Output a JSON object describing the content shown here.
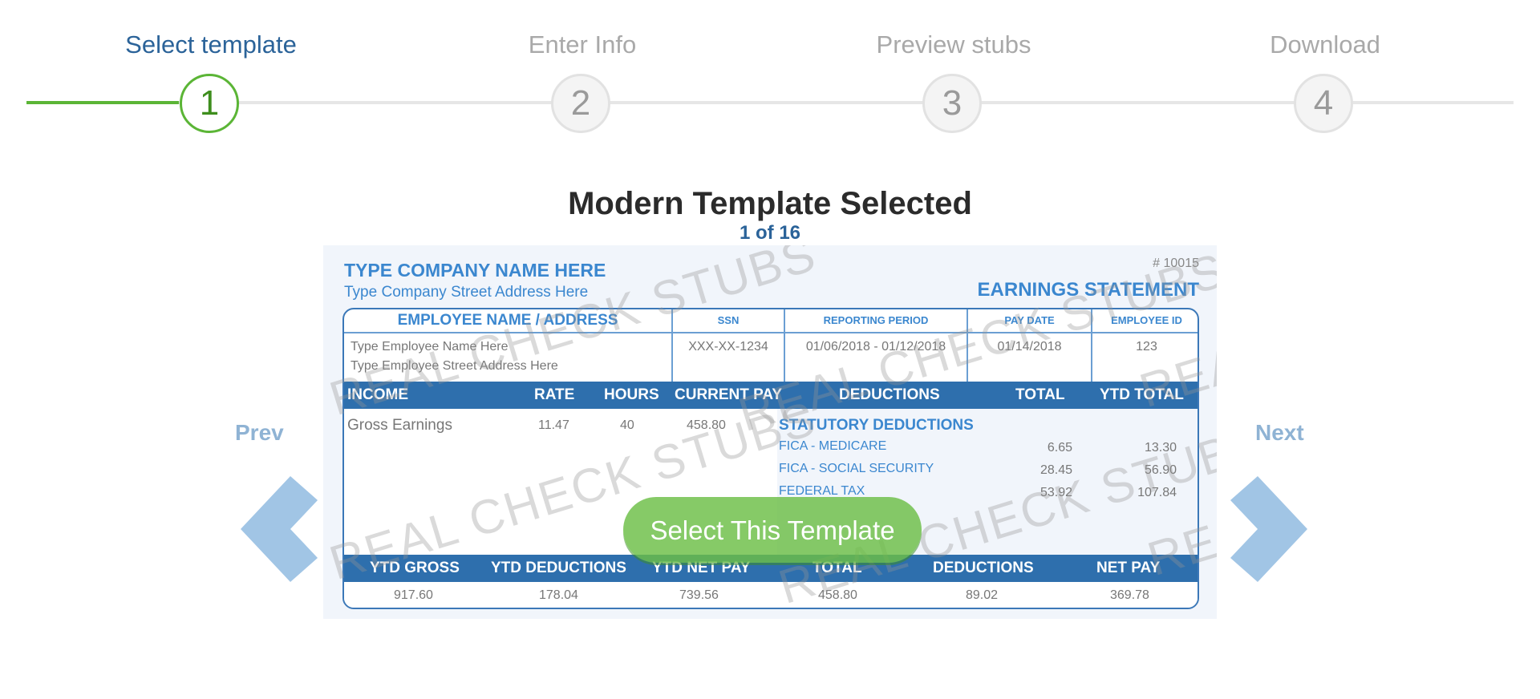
{
  "stepper": {
    "current_step": 1,
    "steps": [
      {
        "number": "1",
        "label": "Select template",
        "state": "active"
      },
      {
        "number": "2",
        "label": "Enter Info",
        "state": "pending"
      },
      {
        "number": "3",
        "label": "Preview stubs",
        "state": "pending"
      },
      {
        "number": "4",
        "label": "Download",
        "state": "pending"
      }
    ]
  },
  "header": {
    "title": "Modern Template Selected",
    "counter": "1 of 16"
  },
  "nav": {
    "prev_label": "Prev",
    "next_label": "Next",
    "prev_icon": "chevron-left-icon",
    "next_icon": "chevron-right-icon"
  },
  "select_button": "Select This Template",
  "stub": {
    "watermark": "REAL CHECK STUBS",
    "company_name": "TYPE COMPANY NAME HERE",
    "company_address": "Type Company Street Address Here",
    "stub_number": "# 10015",
    "heading": "EARNINGS STATEMENT",
    "employee": {
      "header": "EMPLOYEE NAME / ADDRESS",
      "name": "Type Employee Name Here",
      "address": "Type Employee Street Address Here"
    },
    "info": [
      {
        "label": "SSN",
        "value": "XXX-XX-1234"
      },
      {
        "label": "REPORTING PERIOD",
        "value": "01/06/2018 - 01/12/2018"
      },
      {
        "label": "PAY DATE",
        "value": "01/14/2018"
      },
      {
        "label": "EMPLOYEE ID",
        "value": "123"
      }
    ],
    "earnings_headers": [
      "INCOME",
      "RATE",
      "HOURS",
      "CURRENT PAY",
      "DEDUCTIONS",
      "TOTAL",
      "YTD TOTAL"
    ],
    "income_row": {
      "label": "Gross Earnings",
      "rate": "11.47",
      "hours": "40",
      "current_pay": "458.80"
    },
    "deductions_title": "STATUTORY DEDUCTIONS",
    "deductions": [
      {
        "name": "FICA - MEDICARE",
        "total": "6.65",
        "ytd": "13.30"
      },
      {
        "name": "FICA - SOCIAL SECURITY",
        "total": "28.45",
        "ytd": "56.90"
      },
      {
        "name": "FEDERAL TAX",
        "total": "53.92",
        "ytd": "107.84"
      }
    ],
    "summary_headers": [
      "YTD GROSS",
      "YTD DEDUCTIONS",
      "YTD NET PAY",
      "TOTAL",
      "DEDUCTIONS",
      "NET PAY"
    ],
    "summary_values": [
      "917.60",
      "178.04",
      "739.56",
      "458.80",
      "89.02",
      "369.78"
    ]
  },
  "colors": {
    "active_step": "#5bb536",
    "active_label": "#2b6399",
    "stub_blue": "#2e6fad",
    "button_green": "#6bbe46",
    "nav_arrow": "#a1c5e5"
  }
}
